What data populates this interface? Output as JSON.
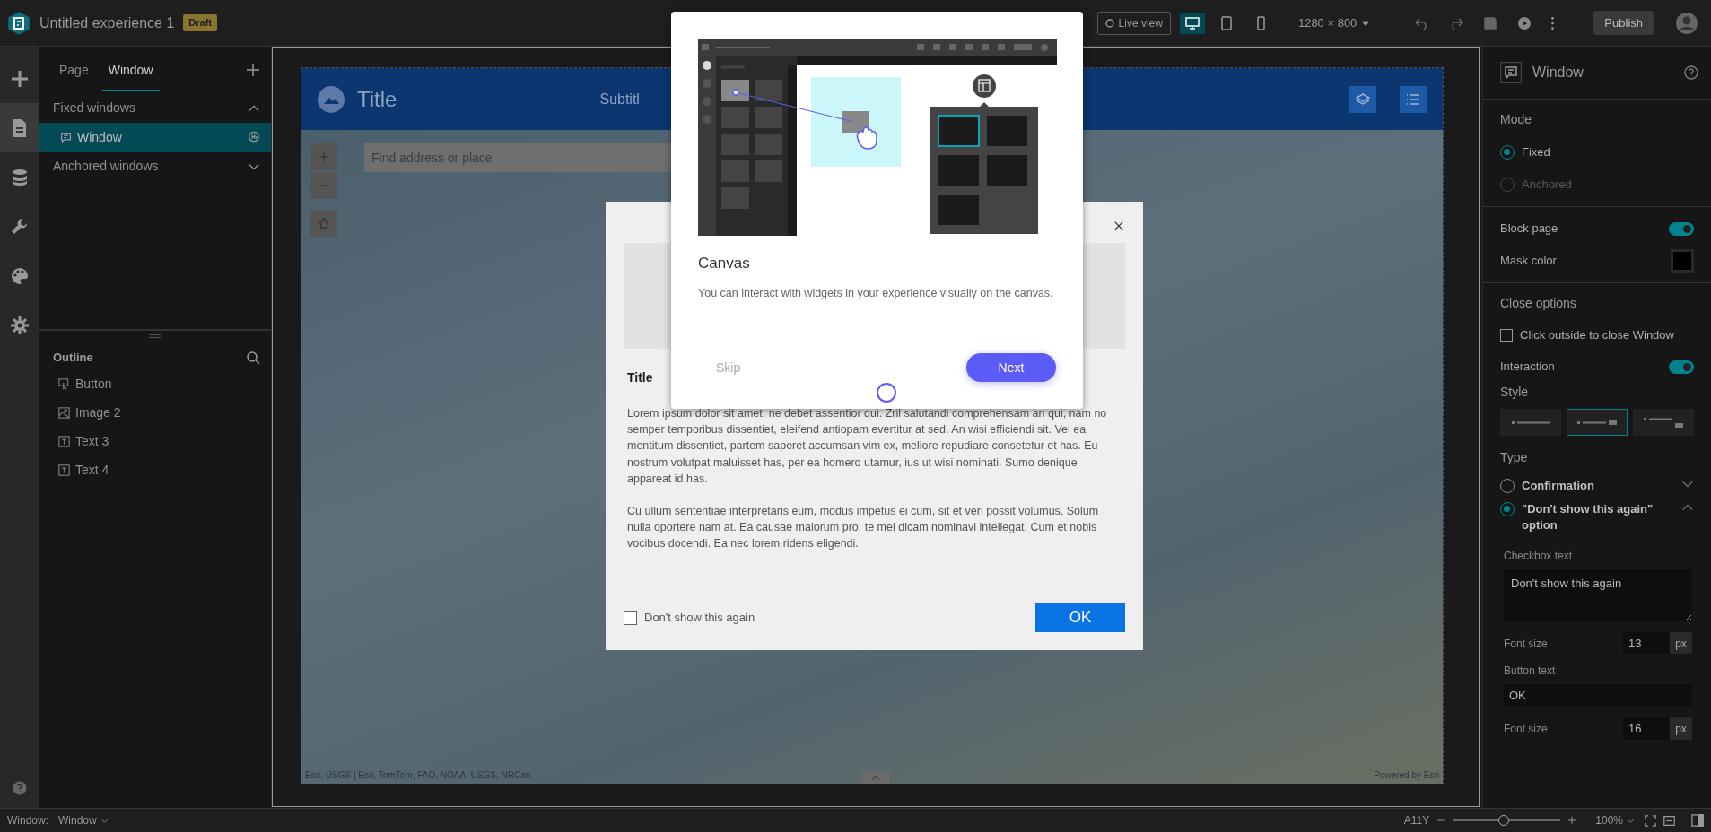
{
  "top_bar": {
    "title": "Untitled experience 1",
    "badge": "Draft",
    "live_view": {
      "label": "Live view",
      "on": false
    },
    "devices": [
      {
        "kind": "desktop",
        "selected": true
      },
      {
        "kind": "tablet",
        "selected": false
      },
      {
        "kind": "phone",
        "selected": false
      }
    ],
    "resolution": "1280 × 800",
    "publish": "Publish"
  },
  "rail": [
    {
      "kind": "add",
      "selected": false
    },
    {
      "kind": "page",
      "selected": true
    },
    {
      "kind": "data",
      "selected": false
    },
    {
      "kind": "widgets",
      "selected": false
    },
    {
      "kind": "theme",
      "selected": false
    },
    {
      "kind": "settings",
      "selected": false
    }
  ],
  "left_panel": {
    "tabs": [
      {
        "label": "Page",
        "selected": false
      },
      {
        "label": "Window",
        "selected": true
      }
    ],
    "groups": [
      {
        "label": "Fixed windows",
        "expanded": true,
        "items": [
          {
            "label": "Window",
            "selected": true
          }
        ]
      },
      {
        "label": "Anchored windows",
        "expanded": false
      }
    ],
    "outline": {
      "title": "Outline",
      "items": [
        {
          "label": "Button",
          "kind": "button"
        },
        {
          "label": "Image 2",
          "kind": "image"
        },
        {
          "label": "Text 3",
          "kind": "text"
        },
        {
          "label": "Text 4",
          "kind": "text"
        }
      ]
    }
  },
  "app": {
    "title": "Title",
    "subtitle": "Subtitl",
    "search": {
      "placeholder": "Find address or place"
    },
    "attribution": "Esri, USGS | Esri, TomTom, FAO, NOAA, USGS, NRCan",
    "powered_by": "Powered by Esri"
  },
  "dialog": {
    "title": "Title",
    "paragraphs": [
      "Lorem ipsum dolor sit amet, ne debet assentior qui. Zril salutandi comprehensam an qui, nam no semper temporibus dissentiet, eleifend antiopam evertitur at sed. An wisi efficiendi sit. Vel ea mentitum dissentiet, partem saperet accumsan vim ex, meliore repudiare consetetur et has. Eu nostrum volutpat maluisset has, per ea homero utamur, ius ut wisi nominati. Sumo denique appareat id has.",
      "Cu ullum sententiae interpretaris eum, modus impetus ei cum, sit et veri possit volumus. Solum nulla oportere nam at. Ea causae maiorum pro, te mel dicam nominavi intellegat. Cum et nobis vocibus docendi. Ea nec lorem ridens eligendi."
    ],
    "checkbox": {
      "label": "Don't show this again",
      "checked": false
    },
    "button": "OK"
  },
  "tour": {
    "title": "Canvas",
    "text": "You can interact with widgets in your experience visually on the canvas.",
    "skip": "Skip",
    "next": "Next"
  },
  "settings": {
    "title": "Window",
    "mode": {
      "label": "Mode",
      "options": [
        {
          "label": "Fixed",
          "selected": true,
          "disabled": false
        },
        {
          "label": "Anchored",
          "selected": false,
          "disabled": true
        }
      ]
    },
    "block_page": {
      "label": "Block page",
      "on": true
    },
    "mask_color": {
      "label": "Mask color",
      "color": "#000000"
    },
    "close_options": {
      "label": "Close options",
      "checkbox": {
        "label": "Click outside to close Window",
        "checked": false
      },
      "interaction": {
        "label": "Interaction",
        "on": true
      },
      "style_label": "Style",
      "styles": [
        {
          "kind": "inline",
          "selected": false
        },
        {
          "kind": "end",
          "selected": true
        },
        {
          "kind": "below",
          "selected": false
        }
      ],
      "type_label": "Type",
      "types": [
        {
          "label": "Confirmation",
          "selected": false,
          "expanded": false
        },
        {
          "label": "\"Don't show this again\" option",
          "selected": true,
          "expanded": true
        }
      ],
      "checkbox_text": {
        "label": "Checkbox text",
        "value": "Don't show this again"
      },
      "font_size_1": {
        "label": "Font size",
        "value": "13",
        "unit": "px"
      },
      "button_text": {
        "label": "Button text",
        "value": "OK"
      },
      "font_size_2": {
        "label": "Font size",
        "value": "16",
        "unit": "px"
      }
    }
  },
  "status_bar": {
    "label": "Window:",
    "value": "Window",
    "a11y": "A11Y",
    "zoom": "100%",
    "level": 0.47
  }
}
